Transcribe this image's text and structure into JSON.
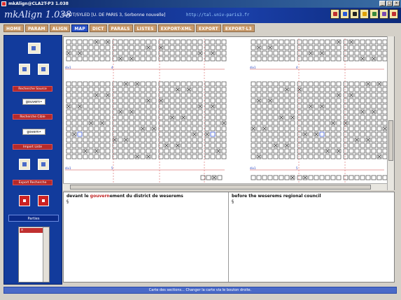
{
  "window": {
    "title": "mkAlign@CLA2T-P3 1.038",
    "buttons": {
      "minimize": "_",
      "maximize": "□",
      "close": "×"
    }
  },
  "header": {
    "app_title": "mkAlign 1.038",
    "corpus": "CLA2T/SYLED [U. DE PARIS 3, Sorbonne nouvelle]",
    "url": "http://tal.univ-paris3.fr"
  },
  "tabs": [
    {
      "label": "HOME",
      "active": false
    },
    {
      "label": "PARAM",
      "active": false
    },
    {
      "label": "ALIGN",
      "active": false
    },
    {
      "label": "MAP",
      "active": true
    },
    {
      "label": "DICT",
      "active": false
    },
    {
      "label": "PARALS",
      "active": false
    },
    {
      "label": "LISTES",
      "active": false
    },
    {
      "label": "EXPORT-XML",
      "active": false
    },
    {
      "label": "EXPORT",
      "active": false
    },
    {
      "label": "EXPORT-L3",
      "active": false
    }
  ],
  "sidebar": {
    "recherche_source_label": "Recherche Source",
    "source_query": "gouvern•",
    "recherche_cible_label": "Recherche Cible",
    "target_query": "govern•",
    "import_liste_label": "Import Liste",
    "export_recherche_label": "Export Recherche",
    "parties_label": "Parties",
    "parties_items": [
      "x"
    ]
  },
  "map": {
    "markers": [
      {
        "left": "div1",
        "num": "4"
      },
      {
        "right": "div1",
        "num": "4"
      },
      {
        "left": "div1",
        "num": "5"
      },
      {
        "right": "div1",
        "num": "5"
      }
    ]
  },
  "segment": {
    "source_before": "devant le ",
    "source_highlight": "gouvern",
    "source_after": "ement du district de weserems",
    "source_para": "§",
    "target": "before the weserems regional council",
    "target_para": "§"
  },
  "status": "Carte des sections... Changer la carte via le bouton droite.",
  "colors": {
    "accent": "#123b9c",
    "highlight": "#c02020",
    "tab": "#c89a6a",
    "tab_active": "#2a52c8"
  }
}
